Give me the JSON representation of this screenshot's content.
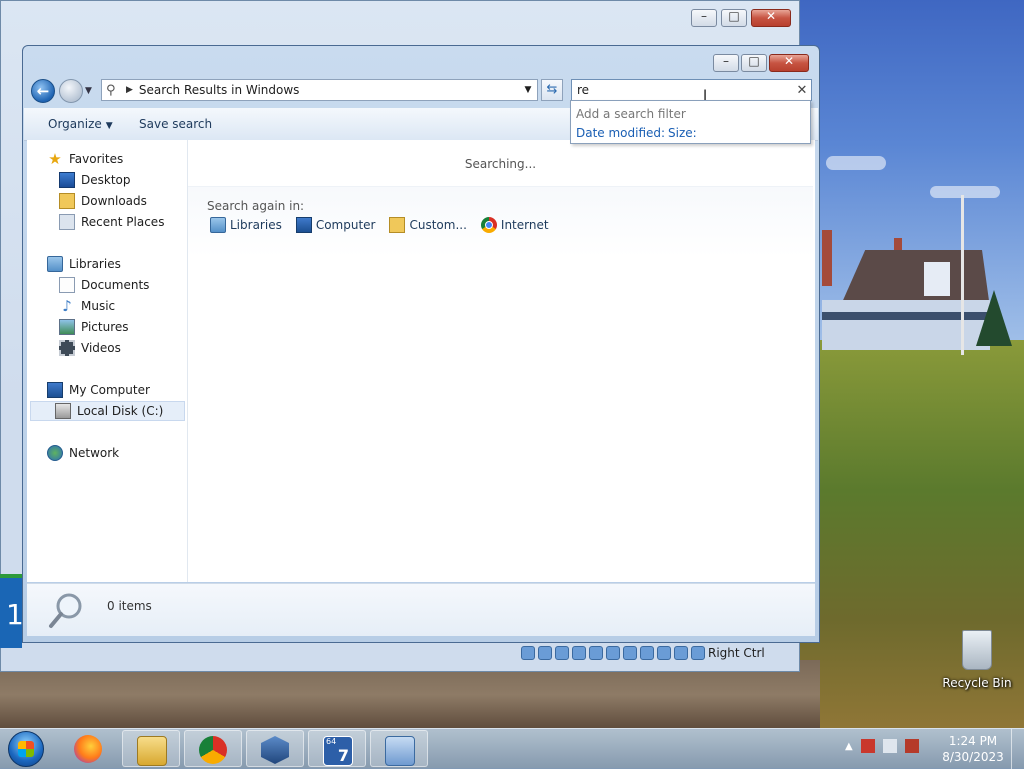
{
  "main_window": {
    "address": {
      "path": "Search Results in Windows"
    },
    "search": {
      "value": "re"
    },
    "toolbar": {
      "organize": "Organize",
      "save_search": "Save search"
    },
    "nav_pane": {
      "favorites": "Favorites",
      "desktop": "Desktop",
      "downloads": "Downloads",
      "recent_places": "Recent Places",
      "libraries": "Libraries",
      "documents": "Documents",
      "music": "Music",
      "pictures": "Pictures",
      "videos": "Videos",
      "my_computer": "My Computer",
      "local_disk": "Local Disk (C:)",
      "network": "Network"
    },
    "content": {
      "searching": "Searching...",
      "search_again_in": "Search again in:",
      "locations": {
        "libraries": "Libraries",
        "computer": "Computer",
        "custom": "Custom...",
        "internet": "Internet"
      }
    },
    "details": {
      "count": "0 items"
    },
    "search_dropdown": {
      "hint": "Add a search filter",
      "date_modified": "Date modified:",
      "size": "Size:"
    }
  },
  "background_window": {
    "status_right_ctrl": "Right Ctrl"
  },
  "desktop": {
    "recycle_bin": "Recycle Bin",
    "edge_digit": "1"
  },
  "taskbar": {
    "clock_time": "1:24 PM",
    "clock_date": "8/30/2023",
    "w7_badge_top": "64",
    "w7_badge": "7"
  },
  "icons": {
    "back": "back-arrow-icon",
    "forward": "forward-arrow-icon",
    "refresh": "refresh-icon",
    "clear": "close-icon",
    "start": "windows-start-icon"
  }
}
